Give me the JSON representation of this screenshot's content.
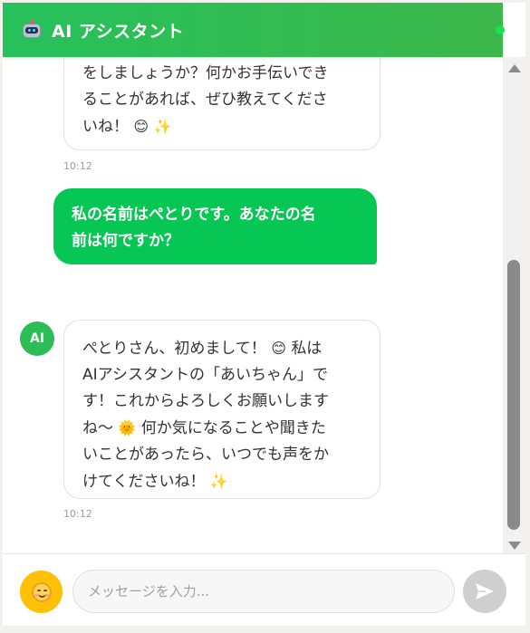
{
  "header": {
    "title": "AI アシスタント",
    "icon": "robot-icon",
    "status_color": "#19e34a",
    "accent": "#26c15b"
  },
  "messages": [
    {
      "sender": "ai",
      "lines": [
        "をしましょうか？何かお手伝いでき",
        "ることがあれば、ぜひ教えてくださ",
        "いね！"
      ],
      "emojis": [
        "😊",
        "✨"
      ],
      "time": "10:12"
    },
    {
      "sender": "user",
      "lines": [
        "私の名前はぺとりです。あなたの名",
        "前は何ですか？"
      ]
    },
    {
      "sender": "ai",
      "avatar": "AI",
      "lines": [
        "ぺとりさん、初めまして！",
        "私は",
        "AIアシスタントの「あいちゃん」で",
        "す！これからよろしくお願いします",
        "ね〜",
        "何か気になることや聞きた",
        "いことがあったら、いつでも声をか",
        "けてくださいね！"
      ],
      "emojis": [
        "😊",
        "🌞",
        "✨"
      ],
      "time": "10:12"
    }
  ],
  "input": {
    "placeholder": "メッセージを入力...",
    "value": "",
    "emoji_button_color": "#ffc107",
    "send_button_color": "#cfcfcf"
  }
}
